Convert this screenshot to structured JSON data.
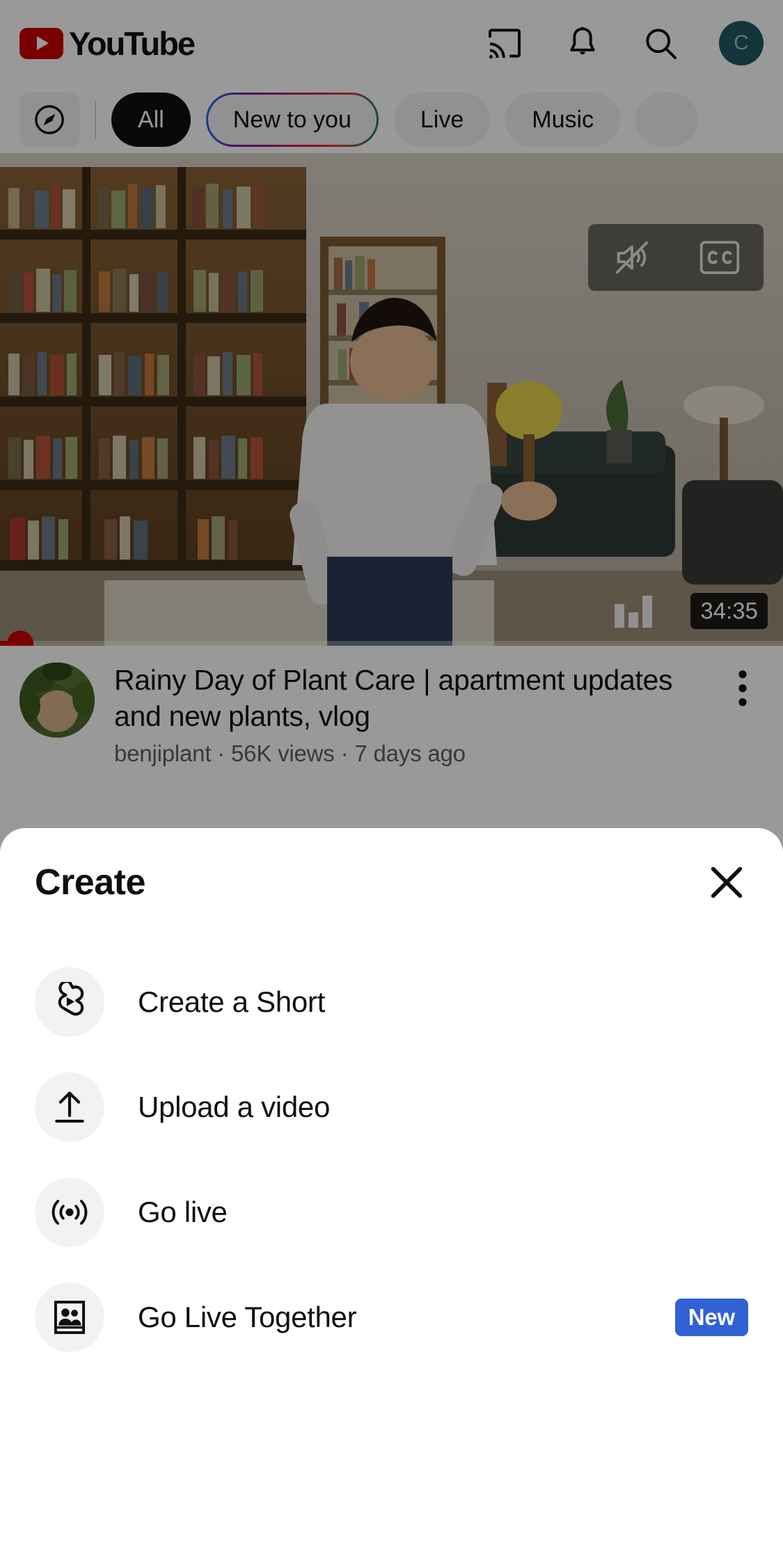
{
  "app": {
    "name": "YouTube",
    "brand_red": "#CC0000"
  },
  "topbar": {
    "logo_text": "YouTube",
    "actions": [
      {
        "name": "cast-icon",
        "label": "Cast"
      },
      {
        "name": "bell-icon",
        "label": "Notifications"
      },
      {
        "name": "search-icon",
        "label": "Search"
      }
    ],
    "avatar": {
      "initial": "C",
      "color": "#1F5863"
    }
  },
  "chips": {
    "explore_icon": "compass-icon",
    "items": [
      {
        "label": "All",
        "selected": true,
        "style": "solid-dark"
      },
      {
        "label": "New to you",
        "selected": false,
        "style": "gradient-outline"
      },
      {
        "label": "Live",
        "selected": false,
        "style": "plain"
      },
      {
        "label": "Music",
        "selected": false,
        "style": "plain"
      },
      {
        "label": "",
        "selected": false,
        "style": "plain-partial"
      }
    ]
  },
  "video": {
    "title": "Rainy Day of Plant Care | apartment updates and new plants, vlog",
    "channel": "benjiplant",
    "views": "56K views",
    "age": "7 days ago",
    "meta_line": "benjiplant · 56K views · 7 days ago",
    "duration": "34:35",
    "overlay_icons": [
      "mute-icon",
      "closed-captions-icon"
    ],
    "analytics_icon": "bar-chart-icon",
    "more_icon": "kebab-menu-icon",
    "progress_percent": 2
  },
  "sheet": {
    "title": "Create",
    "close_icon": "close-icon",
    "items": [
      {
        "label": "Create a Short",
        "icon": "shorts-icon",
        "badge": null
      },
      {
        "label": "Upload a video",
        "icon": "upload-icon",
        "badge": null
      },
      {
        "label": "Go live",
        "icon": "broadcast-icon",
        "badge": null
      },
      {
        "label": "Go Live Together",
        "icon": "people-frame-icon",
        "badge": "New",
        "badge_color": "#3062D5"
      }
    ]
  }
}
